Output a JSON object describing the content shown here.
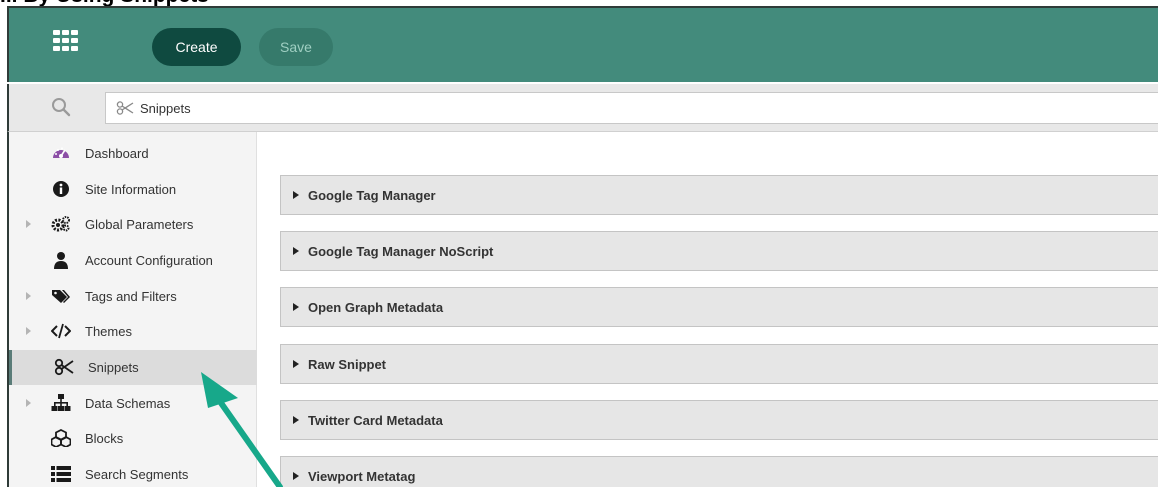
{
  "toolbar": {
    "create_label": "Create",
    "save_label": "Save"
  },
  "search": {
    "value": "Snippets"
  },
  "sidebar": {
    "items": [
      {
        "label": "Dashboard",
        "icon": "dashboard-icon",
        "expandable": false,
        "active": false
      },
      {
        "label": "Site Information",
        "icon": "info-icon",
        "expandable": false,
        "active": false
      },
      {
        "label": "Global Parameters",
        "icon": "gears-icon",
        "expandable": true,
        "active": false
      },
      {
        "label": "Account Configuration",
        "icon": "user-icon",
        "expandable": false,
        "active": false
      },
      {
        "label": "Tags and Filters",
        "icon": "tags-icon",
        "expandable": true,
        "active": false
      },
      {
        "label": "Themes",
        "icon": "code-icon",
        "expandable": true,
        "active": false
      },
      {
        "label": "Snippets",
        "icon": "scissors-icon",
        "expandable": false,
        "active": true
      },
      {
        "label": "Data Schemas",
        "icon": "sitemap-icon",
        "expandable": true,
        "active": false
      },
      {
        "label": "Blocks",
        "icon": "cubes-icon",
        "expandable": false,
        "active": false
      },
      {
        "label": "Search Segments",
        "icon": "list-icon",
        "expandable": false,
        "active": false
      }
    ]
  },
  "main": {
    "panels": [
      {
        "label": "Google Tag Manager"
      },
      {
        "label": "Google Tag Manager NoScript"
      },
      {
        "label": "Open Graph Metadata"
      },
      {
        "label": "Raw Snippet"
      },
      {
        "label": "Twitter Card Metadata"
      },
      {
        "label": "Viewport Metatag"
      }
    ]
  },
  "colors": {
    "topbar": "#438b7c",
    "create_button": "#0f4a40",
    "save_button": "#367a6b",
    "annotation_arrow": "#17a88a"
  }
}
